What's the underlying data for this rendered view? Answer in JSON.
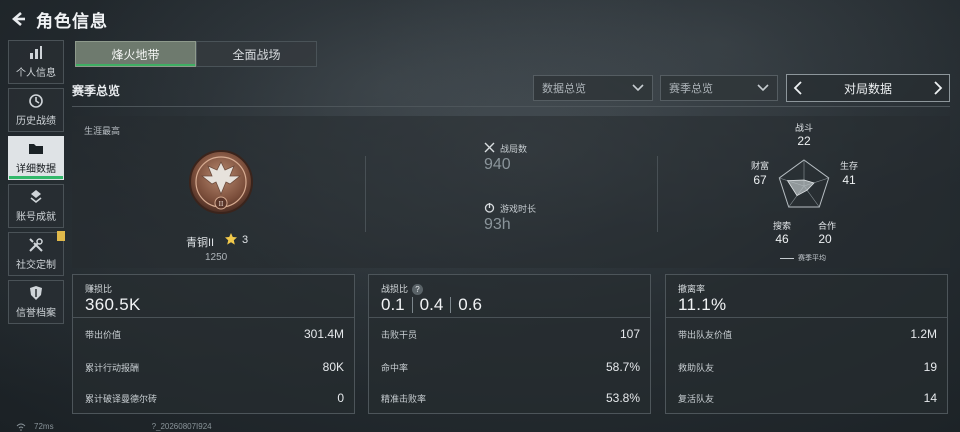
{
  "header": {
    "title": "角色信息",
    "back_icon": "back-arrow-icon"
  },
  "sidebar": {
    "items": [
      {
        "label": "个人信息",
        "icon": "bar-chart-icon"
      },
      {
        "label": "历史战绩",
        "icon": "clock-history-icon"
      },
      {
        "label": "详细数据",
        "icon": "folder-icon",
        "active": true
      },
      {
        "label": "账号成就",
        "icon": "medal-icon"
      },
      {
        "label": "社交定制",
        "icon": "tools-icon",
        "badge": true
      },
      {
        "label": "信誉档案",
        "icon": "shield-icon"
      }
    ]
  },
  "tabs": [
    {
      "label": "烽火地带",
      "active": true
    },
    {
      "label": "全面战场",
      "active": false
    }
  ],
  "section": {
    "title": "赛季总览"
  },
  "filters": {
    "data_overview": "数据总览",
    "season_overview": "赛季总览",
    "pager_label": "对局数据"
  },
  "overview": {
    "career_label": "生涯最高",
    "rank": {
      "name": "青铜II",
      "stars": "3",
      "score": "1250"
    },
    "matches": {
      "label": "战局数",
      "value": "940"
    },
    "playtime": {
      "label": "游戏时长",
      "value": "93h"
    },
    "radar": {
      "combat": {
        "label": "战斗",
        "value": "22"
      },
      "survival": {
        "label": "生存",
        "value": "41"
      },
      "teamwork": {
        "label": "合作",
        "value": "20"
      },
      "search": {
        "label": "搜索",
        "value": "46"
      },
      "wealth": {
        "label": "财富",
        "value": "67"
      },
      "legend": "赛季平均"
    }
  },
  "cards": {
    "profit": {
      "title": "赚损比",
      "value": "360.5K",
      "rows": [
        {
          "label": "带出价值",
          "value": "301.4M"
        },
        {
          "label": "累计行动报酬",
          "value": "80K"
        },
        {
          "label": "累计破译曼德尔砖",
          "value": "0"
        }
      ]
    },
    "kd": {
      "title": "战损比",
      "help": "?",
      "values": [
        "0.1",
        "0.4",
        "0.6"
      ],
      "rows": [
        {
          "label": "击败干员",
          "value": "107"
        },
        {
          "label": "命中率",
          "value": "58.7%"
        },
        {
          "label": "精准击败率",
          "value": "53.8%"
        }
      ]
    },
    "extract": {
      "title": "撤离率",
      "value": "11.1%",
      "rows": [
        {
          "label": "带出队友价值",
          "value": "1.2M"
        },
        {
          "label": "救助队友",
          "value": "19"
        },
        {
          "label": "复活队友",
          "value": "14"
        }
      ]
    }
  },
  "footer": {
    "ping": "72ms",
    "build": "?_20260807I924"
  },
  "colors": {
    "accent_green": "#31b86a",
    "badge_yellow": "#e0b94a"
  }
}
